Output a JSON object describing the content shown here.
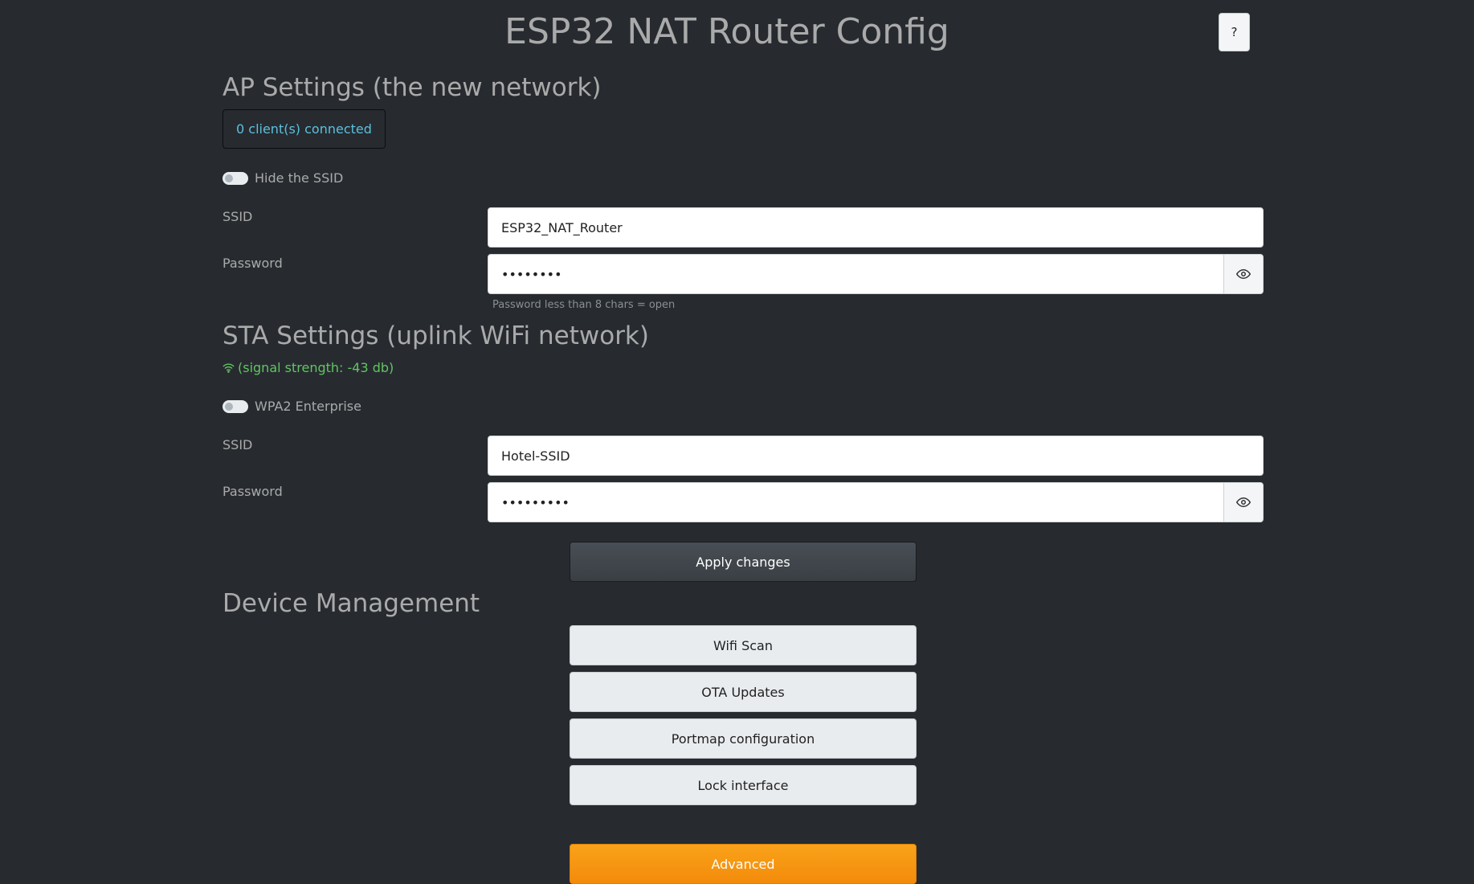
{
  "header": {
    "title": "ESP32 NAT Router Config",
    "help_label": "?"
  },
  "ap": {
    "title": "AP Settings (the new network)",
    "clients_status": "0 client(s) connected",
    "hide_ssid_label": "Hide the SSID",
    "hide_ssid_enabled": false,
    "ssid_label": "SSID",
    "ssid_value": "ESP32_NAT_Router",
    "password_label": "Password",
    "password_value": "••••••••",
    "password_help": "Password less than 8 chars = open"
  },
  "sta": {
    "title": "STA Settings (uplink WiFi network)",
    "signal_text": "(signal strength: -43 db)",
    "wpa2_label": "WPA2 Enterprise",
    "wpa2_enabled": false,
    "ssid_label": "SSID",
    "ssid_value": "Hotel-SSID",
    "password_label": "Password",
    "password_value": "•••••••••"
  },
  "apply_label": "Apply changes",
  "management": {
    "title": "Device Management",
    "wifi_scan_label": "Wifi Scan",
    "ota_label": "OTA Updates",
    "portmap_label": "Portmap configuration",
    "lock_label": "Lock interface",
    "advanced_label": "Advanced"
  },
  "colors": {
    "background": "#272b30",
    "info": "#5bc0de",
    "success": "#62c462",
    "warning": "#f89406"
  }
}
